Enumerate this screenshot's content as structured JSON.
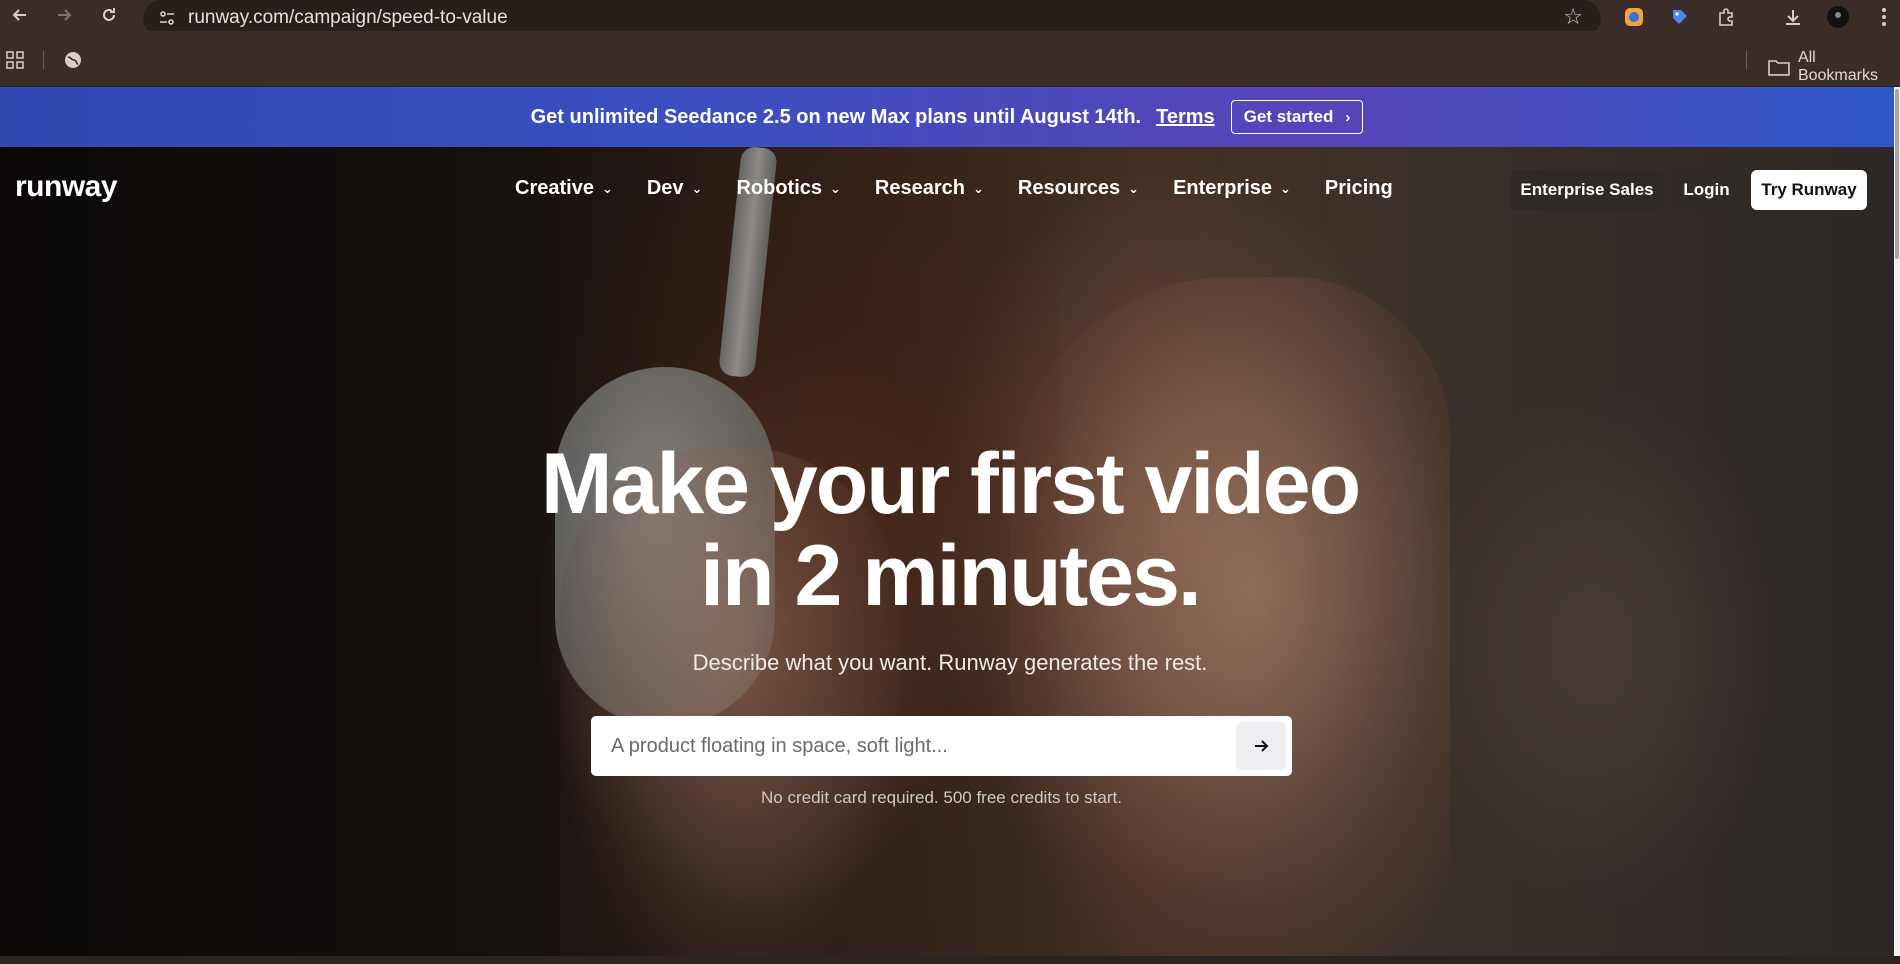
{
  "browser": {
    "url": "runway.com/campaign/speed-to-value",
    "bookmarks_label": "All Bookmarks",
    "colors": {
      "toolbar": "#3a2d27",
      "omnibox": "#281e1a"
    },
    "icons": [
      "back-icon",
      "forward-icon",
      "reload-icon",
      "site-info-icon",
      "star-icon",
      "extension-icon",
      "download-icon",
      "menu-icon",
      "apps-icon",
      "globe-icon",
      "folder-icon"
    ]
  },
  "promo": {
    "text": "Get unlimited Seedance 2.5 on new Max plans until August 14th.",
    "terms_label": "Terms",
    "cta_label": "Get started"
  },
  "nav": {
    "logo": "runway",
    "items": [
      {
        "label": "Creative",
        "has_menu": true
      },
      {
        "label": "Dev",
        "has_menu": true
      },
      {
        "label": "Robotics",
        "has_menu": true
      },
      {
        "label": "Research",
        "has_menu": true
      },
      {
        "label": "Resources",
        "has_menu": true
      },
      {
        "label": "Enterprise",
        "has_menu": true
      },
      {
        "label": "Pricing",
        "has_menu": false
      }
    ],
    "enterprise_sales_label": "Enterprise Sales",
    "login_label": "Login",
    "try_label": "Try Runway"
  },
  "hero": {
    "headline_line1": "Make your first video",
    "headline_line2": "in 2 minutes.",
    "subheadline": "Describe what you want. Runway generates the rest.",
    "prompt_placeholder": "A product floating in space, soft light...",
    "note": "No credit card required. 500 free credits to start."
  }
}
